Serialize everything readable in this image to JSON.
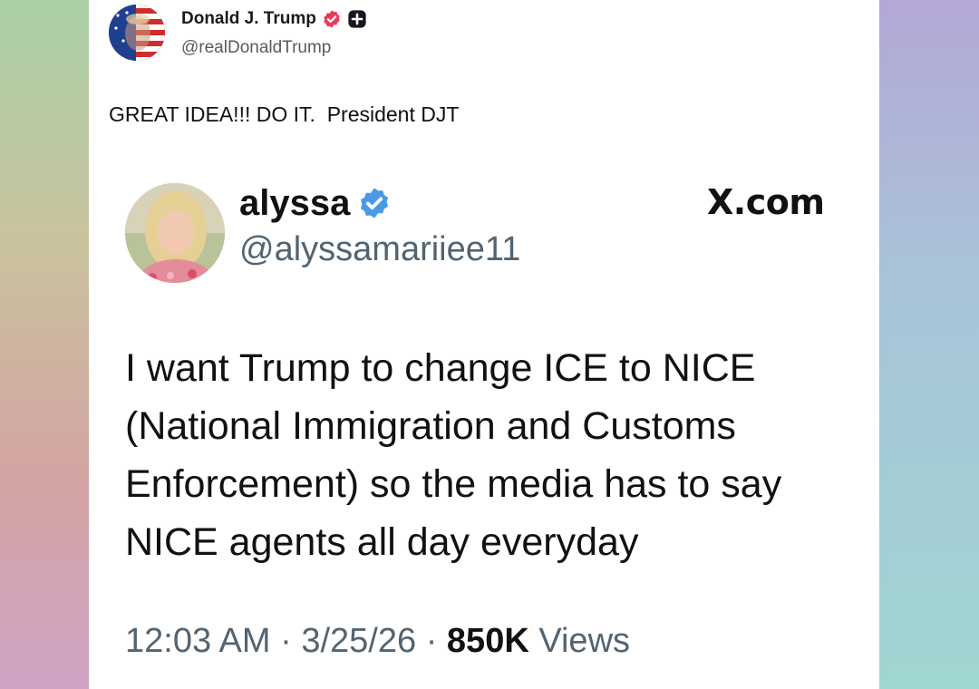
{
  "truth_post": {
    "author_name": "Donald J. Trump",
    "author_handle": "@realDonaldTrump",
    "text": "GREAT IDEA!!! DO IT.  President DJT"
  },
  "embedded_x_post": {
    "author_name": "alyssa",
    "author_handle": "@alyssamariiee11",
    "brand": "X.com",
    "body_lines": [
      "I want Trump to change ICE to NICE",
      "(National Immigration and Customs",
      "Enforcement) so the media has to say",
      "NICE agents all day everyday"
    ],
    "time": "12:03 AM",
    "date": "3/25/26",
    "views_count": "850K",
    "views_label": "Views",
    "separator": "·"
  },
  "colors": {
    "verified_pink": "#e83a5a",
    "verified_blue": "#4a99e9",
    "muted_text": "#536471"
  },
  "icons": {
    "verified_pink": "verified-badge-icon",
    "plus_badge": "plus-badge-icon",
    "verified_blue": "verified-checkmark-icon"
  }
}
